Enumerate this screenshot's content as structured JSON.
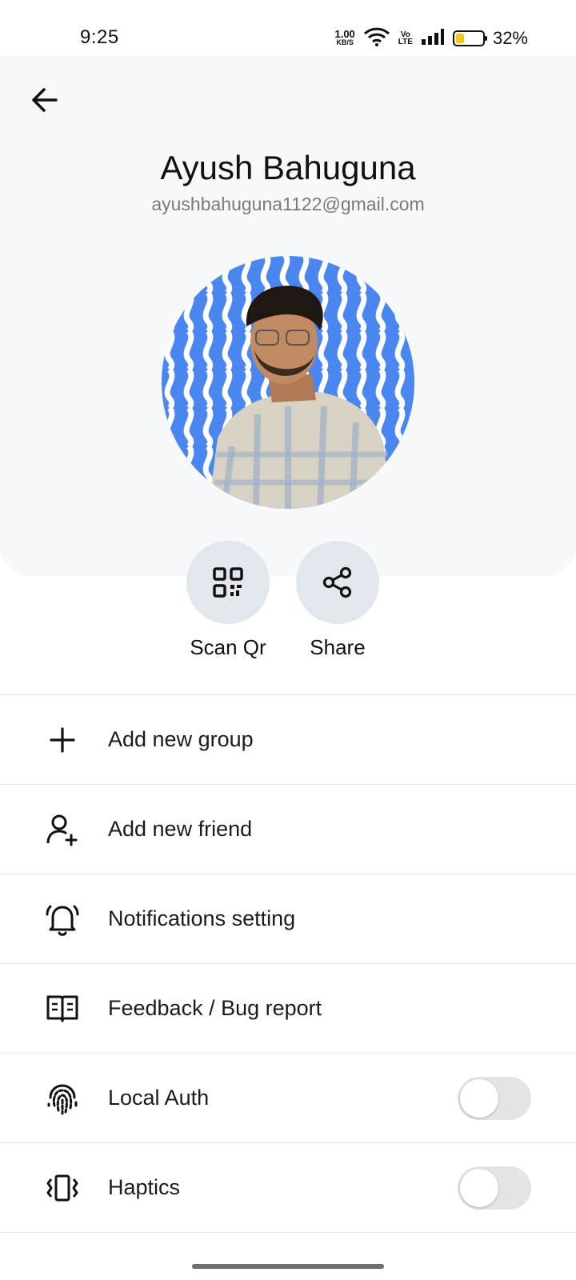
{
  "status_bar": {
    "time": "9:25",
    "net_speed_value": "1.00",
    "net_speed_unit": "KB/S",
    "volte_top": "Vo",
    "volte_bottom": "LTE",
    "battery_percent": "32%",
    "battery_level": 0.32,
    "battery_color": "#f5c518"
  },
  "header": {
    "back_icon": "arrow-left-icon",
    "name": "Ayush Bahuguna",
    "email": "ayushbahuguna1122@gmail.com",
    "avatar_ring_color": "#4285f4"
  },
  "actions": [
    {
      "label": "Scan Qr",
      "icon": "qr-code-icon"
    },
    {
      "label": "Share",
      "icon": "share-icon"
    }
  ],
  "menu": [
    {
      "label": "Add new group",
      "icon": "plus-icon"
    },
    {
      "label": "Add new friend",
      "icon": "add-person-icon"
    },
    {
      "label": "Notifications setting",
      "icon": "bell-icon"
    },
    {
      "label": "Feedback / Bug report",
      "icon": "book-icon"
    },
    {
      "label": "Local Auth",
      "icon": "fingerprint-icon",
      "toggle": false
    },
    {
      "label": "Haptics",
      "icon": "vibration-icon",
      "toggle": false
    }
  ]
}
